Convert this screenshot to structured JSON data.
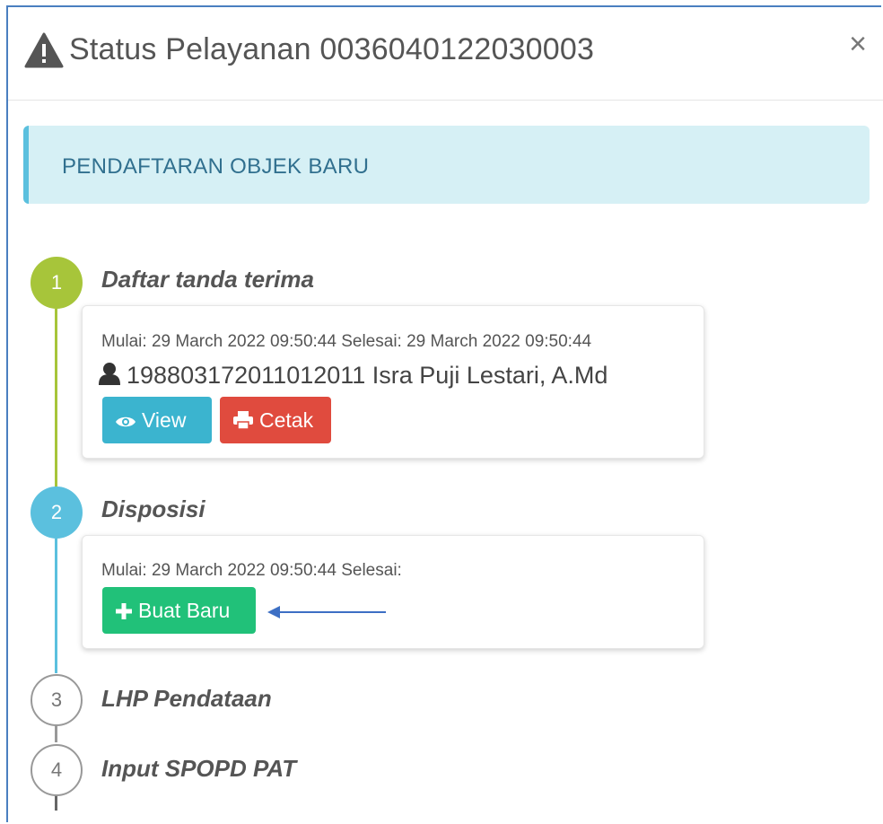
{
  "modal": {
    "title": "Status Pelayanan 0036040122030003",
    "close": "×"
  },
  "alert": {
    "text": "PENDAFTARAN OBJEK BARU",
    "color": "#31708f",
    "background": "#d6f0f5"
  },
  "steps": [
    {
      "number": "1",
      "title": "Daftar tanda terima",
      "color": "#a7c53a",
      "state": "done",
      "meta": "Mulai: 29 March 2022 09:50:44 Selesai: 29 March 2022 09:50:44",
      "person": "198803172011012011 Isra Puji Lestari, A.Md",
      "buttons": {
        "view": "View",
        "print": "Cetak"
      }
    },
    {
      "number": "2",
      "title": "Disposisi",
      "color": "#5bc0de",
      "state": "active",
      "meta": "Mulai: 29 March 2022 09:50:44 Selesai:",
      "buttons": {
        "new": "Buat Baru"
      }
    },
    {
      "number": "3",
      "title": "LHP Pendataan",
      "state": "pending"
    },
    {
      "number": "4",
      "title": "Input SPOPD PAT",
      "state": "pending"
    }
  ],
  "colors": {
    "view_button": "#3bb4cf",
    "print_button": "#e04b3e",
    "new_button": "#21c179",
    "annotation_arrow": "#3d6fc4"
  },
  "icons": [
    "warning-icon",
    "close-icon",
    "user-icon",
    "eye-icon",
    "print-icon",
    "plus-icon"
  ]
}
